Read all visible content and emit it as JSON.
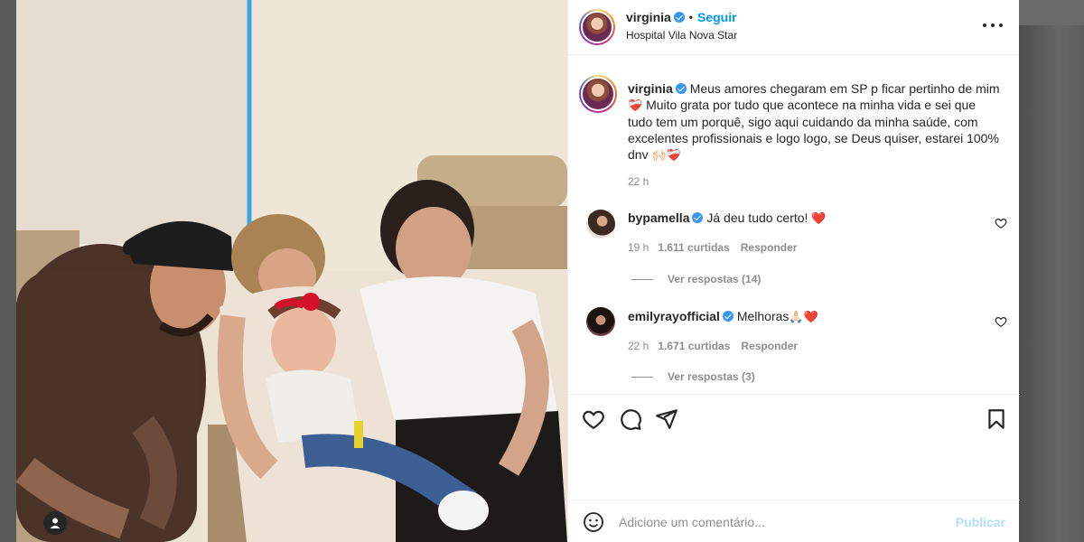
{
  "post": {
    "username": "virginia",
    "follow_label": "Seguir",
    "location": "Hospital Vila Nova Star",
    "caption": "Meus amores chegaram em SP p ficar pertinho de mim",
    "caption_rest": "Muito grata por tudo que acontece na minha vida e sei que tudo tem um porquê, sigo aqui cuidando da minha saúde, com excelentes profissionais e logo logo, se Deus quiser, estarei 100% dnv",
    "caption_emoji_1": "❤️‍🩹",
    "caption_emoji_end": "🙌🏻❤️‍🩹",
    "caption_time": "22 h"
  },
  "comments": [
    {
      "username": "bypamella",
      "text": "Já deu tudo certo!",
      "emoji": "❤️",
      "time": "19 h",
      "likes": "1.611 curtidas",
      "reply_label": "Responder",
      "view_replies": "Ver respostas (14)"
    },
    {
      "username": "emilyrayofficial",
      "text": "Melhoras",
      "emoji": "🙏🏻❤️",
      "time": "22 h",
      "likes": "1.671 curtidas",
      "reply_label": "Responder",
      "view_replies": "Ver respostas (3)"
    }
  ],
  "composer": {
    "placeholder": "Adicione um comentário...",
    "publish_label": "Publicar"
  },
  "icons": {
    "like": "heart-icon",
    "comment": "comment-icon",
    "share": "send-icon",
    "save": "bookmark-icon",
    "emoji": "smiley-icon",
    "more": "more-dots-icon",
    "tag": "user-tag-icon"
  },
  "colors": {
    "link_blue": "#0095f6",
    "verified_blue": "#3897f0",
    "muted_text": "#8e8e8e",
    "publish_disabled": "#b2dffc"
  }
}
